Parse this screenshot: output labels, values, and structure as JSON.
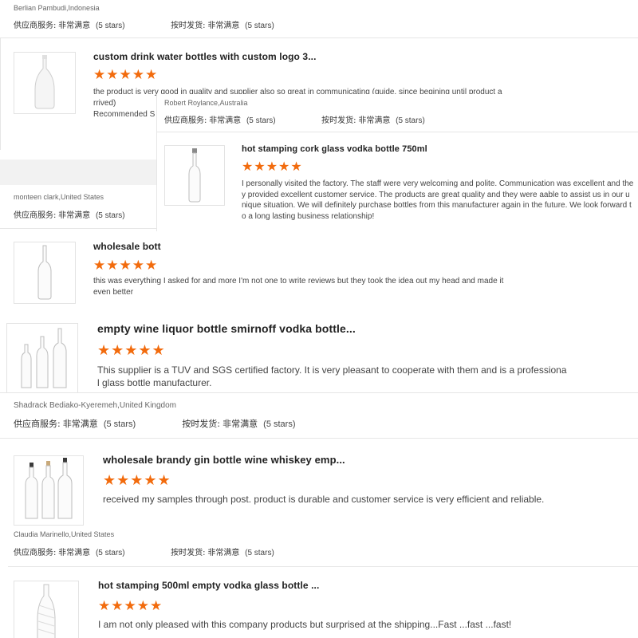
{
  "labels": {
    "supplier_service": "供应商服务:",
    "on_time_delivery": "按时发货:",
    "very_satisfied": "非常满意",
    "five_stars": "(5 stars)",
    "stars_glyphs": "★★★★★",
    "recommended_fragment": "Recommended S"
  },
  "colors": {
    "star": "#f26b0d",
    "divider": "#e6e6e6",
    "band": "#f2f2f2"
  },
  "reviews": [
    {
      "reviewer": "Berlian Pambudi,Indonesia"
    },
    {
      "product_title": "custom drink water bottles with custom logo 3...",
      "comment": "the product is very good in quality and supplier also so great in communicating (guide, since begining until product arrived)",
      "reviewer": "Robert Roylance,Australia"
    },
    {
      "product_title": "hot stamping cork glass vodka bottle 750ml",
      "comment": "I personally visited the factory.   The staff were very welcoming and polite.  Communication  was  excellent and they provided excellent customer service. The products are great quality and they were aable to assist us in our unique situation. We will definitely purchase bottles from this manufacturer again in the future. We look forward to a long lasting business relationship!",
      "reviewer": "monteen clark,United States"
    },
    {
      "product_title": "wholesale bott",
      "comment": "this was everything I asked for and more I'm not one to write reviews but they took the idea out my head and made it even better"
    },
    {
      "product_title": "empty wine liquor bottle smirnoff vodka bottle...",
      "comment": "This supplier is a TUV and SGS certified factory. It is very pleasant to cooperate with them and is a professional glass bottle manufacturer.",
      "reviewer": "Shadrack Bediako-Kyeremeh,United Kingdom"
    },
    {
      "product_title": "wholesale brandy gin bottle wine whiskey emp...",
      "comment": "received my samples through post. product is durable and customer service is very efficient and reliable.",
      "reviewer": "Claudia Marinello,United States"
    },
    {
      "product_title": "hot stamping 500ml empty vodka glass bottle ...",
      "comment": "I am not only pleased with this company products but surprised at the shipping...Fast ...fast ...fast!"
    }
  ]
}
